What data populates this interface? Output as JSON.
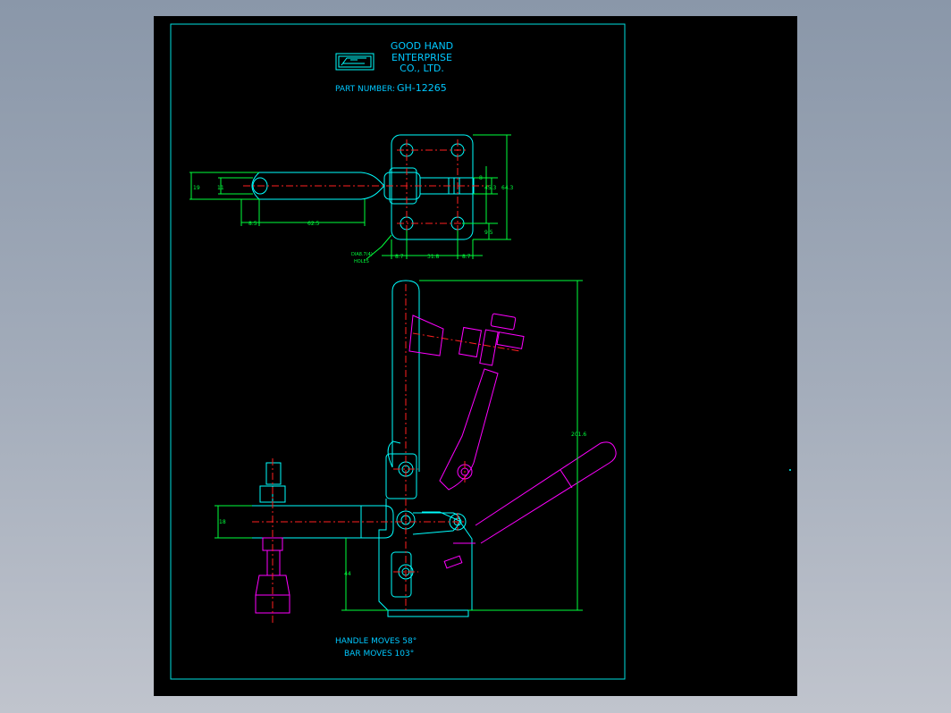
{
  "title_block": {
    "company_line1": "GOOD HAND",
    "company_line2": "ENTERPRISE",
    "company_line3": "CO., LTD.",
    "part_label": "PART NUMBER:",
    "part_number": "GH-12265"
  },
  "top_view": {
    "dim_19": "19",
    "dim_11": "11",
    "dim_85": "8.5",
    "dim_625": "62.5",
    "dim_8": "8",
    "dim_453": "45.3",
    "dim_643": "64.3",
    "dim_95": "9.5",
    "dim_87a": "8.7",
    "dim_318": "31.8",
    "dim_87b": "8.7",
    "holes_note_line1": "DIA8.7(4)",
    "holes_note_line2": "HOLES"
  },
  "side_view": {
    "dim_2016": "201.6",
    "dim_18": "18",
    "dim_44": "44"
  },
  "notes": {
    "handle_moves": "HANDLE MOVES 58°",
    "bar_moves": "BAR MOVES 103°"
  },
  "colors": {
    "frame": "#00e0e0",
    "outline": "#00ffff",
    "dimension": "#00ff3c",
    "motion_path": "#ff00ff",
    "centerline": "#ff2020",
    "text": "#00c8ff"
  }
}
